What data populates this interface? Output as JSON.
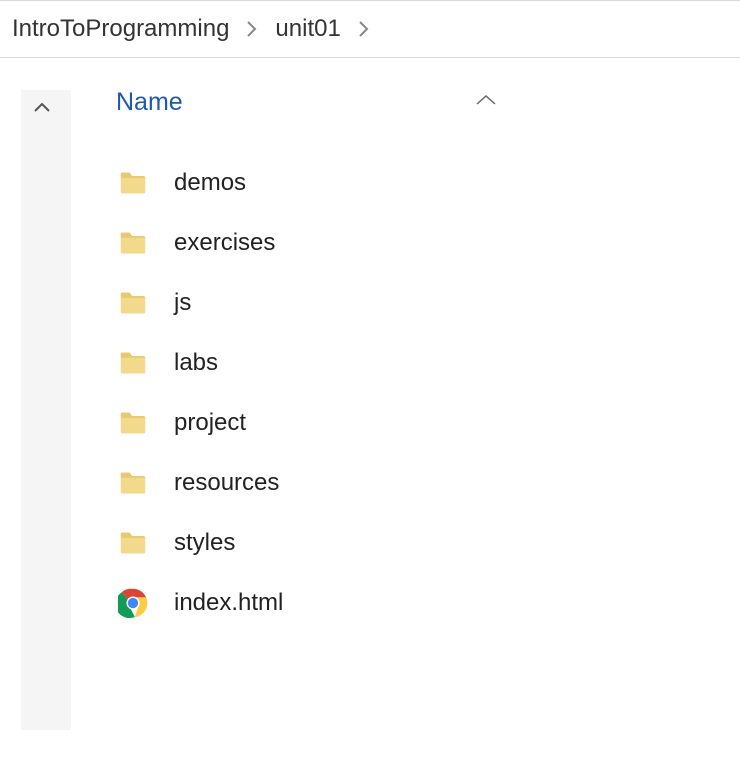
{
  "breadcrumb": {
    "segments": [
      {
        "label": "IntroToProgramming"
      },
      {
        "label": "unit01"
      }
    ]
  },
  "columns": {
    "name_header": "Name"
  },
  "items": [
    {
      "name": "demos",
      "type": "folder"
    },
    {
      "name": "exercises",
      "type": "folder"
    },
    {
      "name": "js",
      "type": "folder"
    },
    {
      "name": "labs",
      "type": "folder"
    },
    {
      "name": "project",
      "type": "folder"
    },
    {
      "name": "resources",
      "type": "folder"
    },
    {
      "name": "styles",
      "type": "folder"
    },
    {
      "name": "index.html",
      "type": "html"
    }
  ]
}
